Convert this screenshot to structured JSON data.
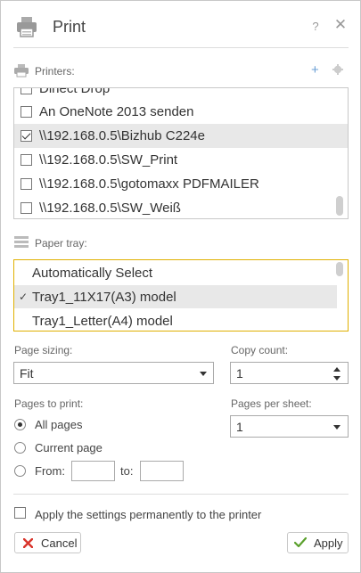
{
  "header": {
    "title": "Print",
    "help_label": "?",
    "close_label": "✕"
  },
  "printers": {
    "label": "Printers:",
    "add_label": "+",
    "items": [
      {
        "label": "Dinect Drop",
        "checked": false
      },
      {
        "label": "An OneNote 2013 senden",
        "checked": false
      },
      {
        "label": "\\\\192.168.0.5\\Bizhub C224e",
        "checked": true,
        "selected": true
      },
      {
        "label": "\\\\192.168.0.5\\SW_Print",
        "checked": false
      },
      {
        "label": "\\\\192.168.0.5\\gotomaxx PDFMAILER",
        "checked": false
      },
      {
        "label": "\\\\192.168.0.5\\SW_Weiß",
        "checked": false
      }
    ]
  },
  "paper_tray": {
    "label": "Paper tray:",
    "items": [
      {
        "label": "Automatically Select",
        "selected": false
      },
      {
        "label": "Tray1_11X17(A3) model",
        "selected": true,
        "check": "✓"
      },
      {
        "label": "Tray1_Letter(A4) model",
        "selected": false
      }
    ]
  },
  "page_sizing": {
    "label": "Page sizing:",
    "value": "Fit"
  },
  "copy_count": {
    "label": "Copy count:",
    "value": "1"
  },
  "pages_to_print": {
    "label": "Pages to print:",
    "options": [
      {
        "label": "All pages",
        "selected": true
      },
      {
        "label": "Current page",
        "selected": false
      },
      {
        "label": "From:",
        "selected": false
      }
    ],
    "to_label": "to:",
    "from_value": "",
    "to_value": ""
  },
  "pages_per_sheet": {
    "label": "Pages per sheet:",
    "value": "1"
  },
  "apply_permanently": {
    "label": "Apply the settings permanently to the printer",
    "checked": false
  },
  "buttons": {
    "cancel": "Cancel",
    "apply": "Apply"
  },
  "colors": {
    "accent_blue": "#6a9fd4",
    "cancel_red": "#d9342b",
    "apply_green": "#5aa02c",
    "tray_border": "#e0b000",
    "selection": "#e8e8e8"
  }
}
